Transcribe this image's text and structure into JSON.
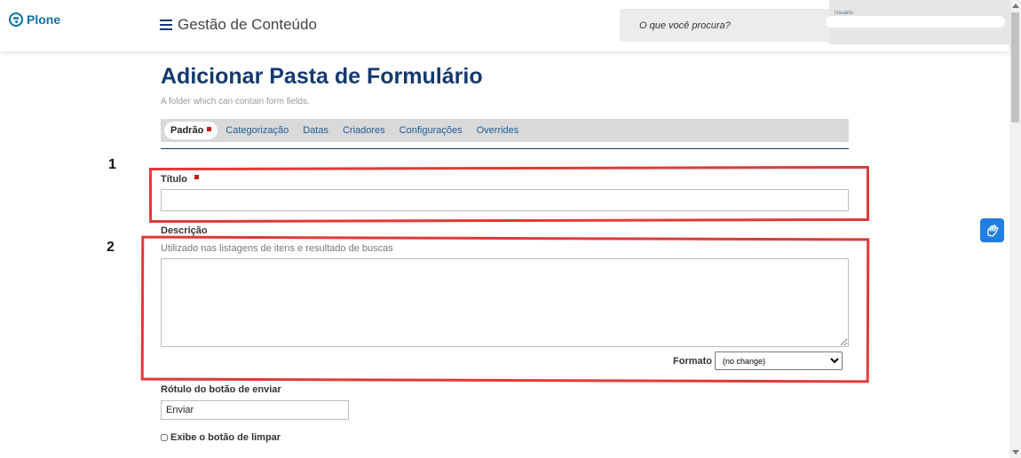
{
  "header": {
    "logo_text": "Plone",
    "menu_title": "Gestão de Conteúdo",
    "search_placeholder": "O que você procura?",
    "user_label": "Usuário"
  },
  "page": {
    "title": "Adicionar Pasta de Formulário",
    "description": "A folder which can contain form fields."
  },
  "tabs": [
    {
      "label": "Padrão",
      "active": true,
      "required": true
    },
    {
      "label": "Categorização"
    },
    {
      "label": "Datas"
    },
    {
      "label": "Criadores"
    },
    {
      "label": "Configurações"
    },
    {
      "label": "Overrides"
    }
  ],
  "form": {
    "title_label": "Título",
    "title_value": "",
    "description_label": "Descrição",
    "description_hint": "Utilizado nas listagens de itens e resultado de buscas",
    "description_value": "",
    "format_label": "Formato",
    "format_selected": "(no change)",
    "submit_label_label": "Rótulo do botão de enviar",
    "submit_label_value": "Enviar",
    "clear_button_label": "Exibe o botão de limpar"
  },
  "annotations": [
    "1",
    "2"
  ],
  "colors": {
    "brand": "#0b6fa6",
    "title": "#133a6e",
    "tab_link": "#1f5a96",
    "required": "#d01b1b",
    "annotation": "#e03a3a",
    "a11y": "#1f7ee0"
  },
  "icons": {
    "logo": "plone-logo-icon",
    "menu": "hamburger-icon",
    "accessibility": "sign-language-icon"
  }
}
